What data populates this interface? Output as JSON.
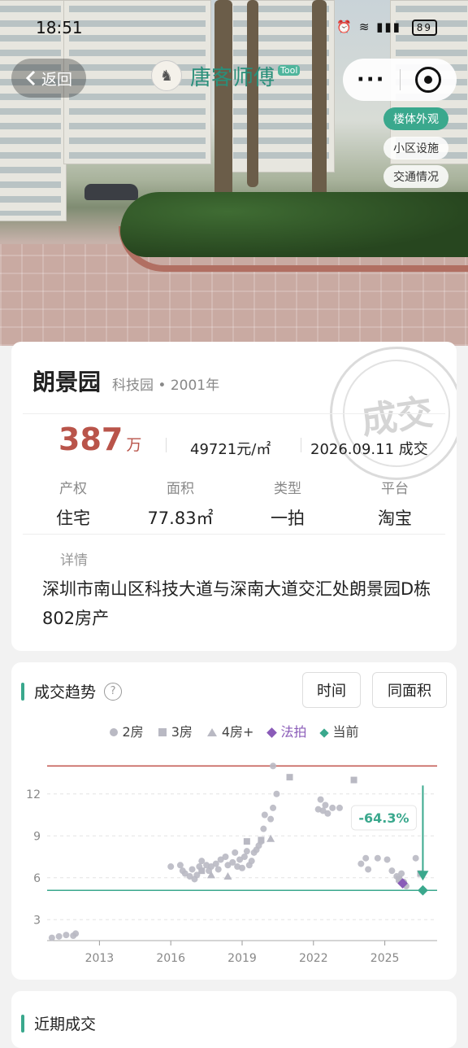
{
  "status_bar": {
    "time": "18:51",
    "battery": "89"
  },
  "nav": {
    "back_label": "返回",
    "brand_name": "唐客师傅",
    "brand_tag": "Tool"
  },
  "photo_tabs": [
    "楼体外观",
    "小区设施",
    "交通情况"
  ],
  "property": {
    "name": "朗景园",
    "district": "科技园",
    "year": "2001年",
    "stamp": "成交",
    "price": "387",
    "price_unit": "万",
    "unit_price": "49721元/㎡",
    "deal_date": "2026.09.11 成交",
    "attributes": [
      {
        "label": "产权",
        "value": "住宅"
      },
      {
        "label": "面积",
        "value": "77.83㎡"
      },
      {
        "label": "类型",
        "value": "一拍"
      },
      {
        "label": "平台",
        "value": "淘宝"
      }
    ],
    "detail_label": "详情",
    "detail_text": "深圳市南山区科技大道与深南大道交汇处朗景园D栋802房产"
  },
  "trend": {
    "title": "成交趋势",
    "help": "?",
    "buttons": [
      "时间",
      "同面积"
    ],
    "legend": [
      "2房",
      "3房",
      "4房+",
      "法拍",
      "当前"
    ]
  },
  "chart_data": {
    "type": "scatter",
    "x_ticks": [
      "2013",
      "2016",
      "2019",
      "2022",
      "2025"
    ],
    "y_ticks": [
      "3",
      "6",
      "9",
      "12"
    ],
    "xlim": [
      2010.8,
      2027.2
    ],
    "ylim": [
      1.5,
      14.2
    ],
    "reference_lines": {
      "high": 14.0,
      "current": 5.1
    },
    "change_label": "-64.3%",
    "colors": {
      "room": "#b9b9c3",
      "auction": "#8a5bb8",
      "current": "#3aa88d",
      "high": "#c0504a"
    },
    "series": [
      {
        "name": "2房",
        "marker": "circle",
        "points": [
          [
            2011.0,
            1.7
          ],
          [
            2011.3,
            1.8
          ],
          [
            2011.6,
            1.9
          ],
          [
            2011.9,
            1.85
          ],
          [
            2012.0,
            2.0
          ],
          [
            2016.0,
            6.8
          ],
          [
            2016.4,
            6.9
          ],
          [
            2016.5,
            6.5
          ],
          [
            2016.6,
            6.3
          ],
          [
            2016.8,
            6.1
          ],
          [
            2016.9,
            6.6
          ],
          [
            2017.0,
            5.9
          ],
          [
            2017.1,
            6.2
          ],
          [
            2017.2,
            6.8
          ],
          [
            2017.3,
            7.2
          ],
          [
            2017.5,
            6.9
          ],
          [
            2017.6,
            6.5
          ],
          [
            2017.7,
            6.8
          ],
          [
            2017.9,
            7.0
          ],
          [
            2018.0,
            6.6
          ],
          [
            2018.1,
            7.3
          ],
          [
            2018.3,
            7.5
          ],
          [
            2018.4,
            6.9
          ],
          [
            2018.6,
            7.1
          ],
          [
            2018.7,
            7.8
          ],
          [
            2018.8,
            6.8
          ],
          [
            2018.9,
            7.3
          ],
          [
            2019.0,
            6.7
          ],
          [
            2019.1,
            7.5
          ],
          [
            2019.2,
            7.9
          ],
          [
            2019.3,
            6.9
          ],
          [
            2019.4,
            7.2
          ],
          [
            2019.5,
            7.8
          ],
          [
            2019.6,
            8.0
          ],
          [
            2019.7,
            8.3
          ],
          [
            2019.8,
            8.6
          ],
          [
            2019.9,
            9.5
          ],
          [
            2019.95,
            10.5
          ],
          [
            2020.2,
            10.2
          ],
          [
            2020.3,
            11.0
          ],
          [
            2020.45,
            12.0
          ],
          [
            2020.3,
            14.0
          ],
          [
            2022.2,
            10.9
          ],
          [
            2022.3,
            11.6
          ],
          [
            2022.4,
            10.8
          ],
          [
            2022.5,
            11.2
          ],
          [
            2022.6,
            10.6
          ],
          [
            2022.8,
            11.0
          ],
          [
            2023.1,
            11.0
          ],
          [
            2024.0,
            7.0
          ],
          [
            2024.2,
            7.4
          ],
          [
            2024.3,
            6.6
          ],
          [
            2024.7,
            7.4
          ],
          [
            2025.1,
            7.3
          ],
          [
            2025.3,
            6.5
          ],
          [
            2025.5,
            6.1
          ],
          [
            2025.6,
            5.8
          ],
          [
            2025.7,
            6.3
          ],
          [
            2025.8,
            5.7
          ],
          [
            2025.9,
            5.4
          ],
          [
            2026.3,
            7.4
          ]
        ]
      },
      {
        "name": "3房",
        "marker": "square",
        "points": [
          [
            2017.3,
            6.5
          ],
          [
            2019.2,
            8.6
          ],
          [
            2019.8,
            8.7
          ],
          [
            2021.0,
            13.2
          ],
          [
            2023.7,
            13.0
          ],
          [
            2025.6,
            5.9
          ],
          [
            2026.5,
            6.3
          ]
        ]
      },
      {
        "name": "4房+",
        "marker": "triangle",
        "points": [
          [
            2017.7,
            6.2
          ],
          [
            2018.4,
            6.1
          ],
          [
            2020.2,
            8.8
          ]
        ]
      },
      {
        "name": "法拍",
        "marker": "diamond",
        "points": [
          [
            2025.75,
            5.6
          ]
        ]
      },
      {
        "name": "当前",
        "marker": "diamond",
        "points": [
          [
            2026.6,
            5.1
          ]
        ]
      }
    ]
  },
  "recent": {
    "title": "近期成交"
  }
}
